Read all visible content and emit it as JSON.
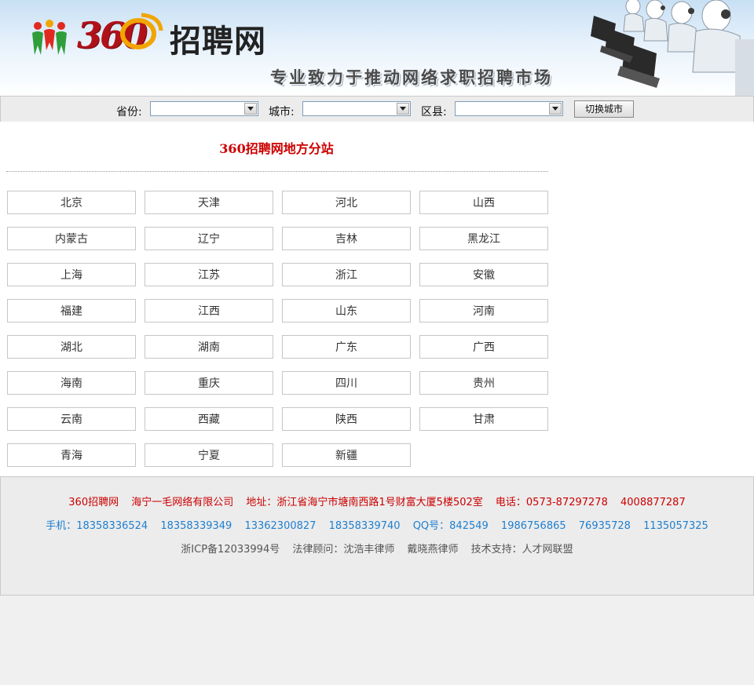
{
  "header": {
    "logo_number": "360",
    "logo_title": "招聘网",
    "slogan": "专业致力于推动网络求职招聘市场"
  },
  "selector": {
    "province_label": "省份:",
    "city_label": "城市:",
    "county_label": "区县:",
    "province_value": "",
    "city_value": "",
    "county_value": "",
    "switch_label": "切换城市"
  },
  "main": {
    "heading": "360招聘网地方分站",
    "regions": [
      "北京",
      "天津",
      "河北",
      "山西",
      "内蒙古",
      "辽宁",
      "吉林",
      "黑龙江",
      "上海",
      "江苏",
      "浙江",
      "安徽",
      "福建",
      "江西",
      "山东",
      "河南",
      "湖北",
      "湖南",
      "广东",
      "广西",
      "海南",
      "重庆",
      "四川",
      "贵州",
      "云南",
      "西藏",
      "陕西",
      "甘肃",
      "青海",
      "宁夏",
      "新疆"
    ]
  },
  "footer": {
    "line1": [
      "360招聘网",
      "海宁一毛网络有限公司",
      "地址：浙江省海宁市塘南西路1号财富大厦5楼502室",
      "电话：0573-87297278",
      "4008877287"
    ],
    "line2": [
      "手机：18358336524",
      "18358339349",
      "13362300827",
      "18358339740",
      "QQ号：842549",
      "1986756865",
      "76935728",
      "1135057325"
    ],
    "line3": [
      "浙ICP备12033994号",
      "法律顾问：沈浩丰律师",
      "戴晓燕律师",
      "技术支持：人才网联盟"
    ]
  },
  "colors": {
    "accent_red": "#cc0000",
    "link_blue": "#1e7fd0",
    "banner_blue": "#c8e0f4"
  },
  "icons": [
    "people-logo-icon",
    "dropdown-arrow-icon",
    "call-center-operators-image"
  ]
}
